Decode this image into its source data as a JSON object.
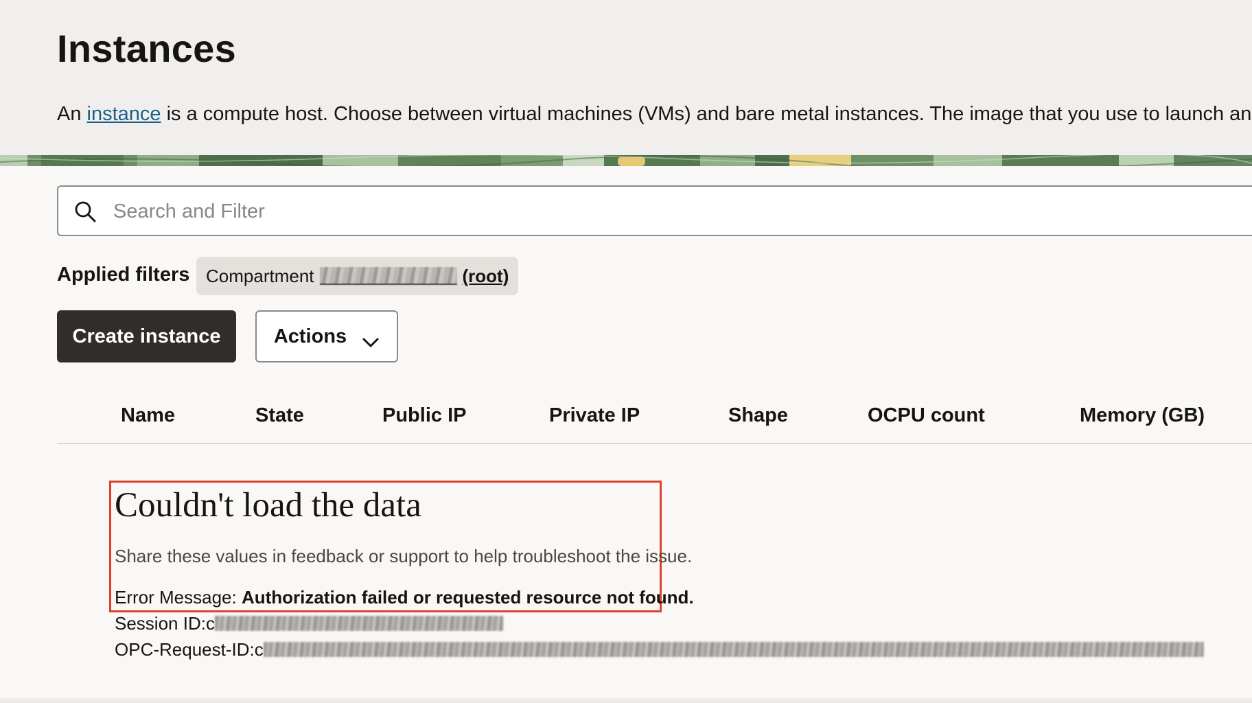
{
  "header": {
    "title": "Instances",
    "description_prefix": "An ",
    "description_link": "instance",
    "description_suffix": " is a compute host. Choose between virtual machines (VMs) and bare metal instances. The image that you use to launch an ins"
  },
  "search": {
    "placeholder": "Search and Filter",
    "icon": "search-icon"
  },
  "filters": {
    "label": "Applied filters",
    "chip_label": "Compartment",
    "chip_suffix": "(root)"
  },
  "toolbar": {
    "create_label": "Create instance",
    "actions_label": "Actions",
    "actions_icon": "chevron-down-icon"
  },
  "table": {
    "columns": [
      "Name",
      "State",
      "Public IP",
      "Private IP",
      "Shape",
      "OCPU count",
      "Memory (GB)"
    ]
  },
  "error": {
    "title": "Couldn't load the data",
    "hint": "Share these values in feedback or support to help troubleshoot the issue.",
    "message_label": "Error Message: ",
    "message_value": "Authorization failed or requested resource not found.",
    "session_label": "Session ID: ",
    "session_value_prefix": "c",
    "request_label": "OPC-Request-ID: ",
    "request_value_prefix": "c"
  },
  "colors": {
    "accent_link": "#1b5f8a",
    "error_outline": "#e0402e",
    "primary_button": "#312d2a"
  }
}
